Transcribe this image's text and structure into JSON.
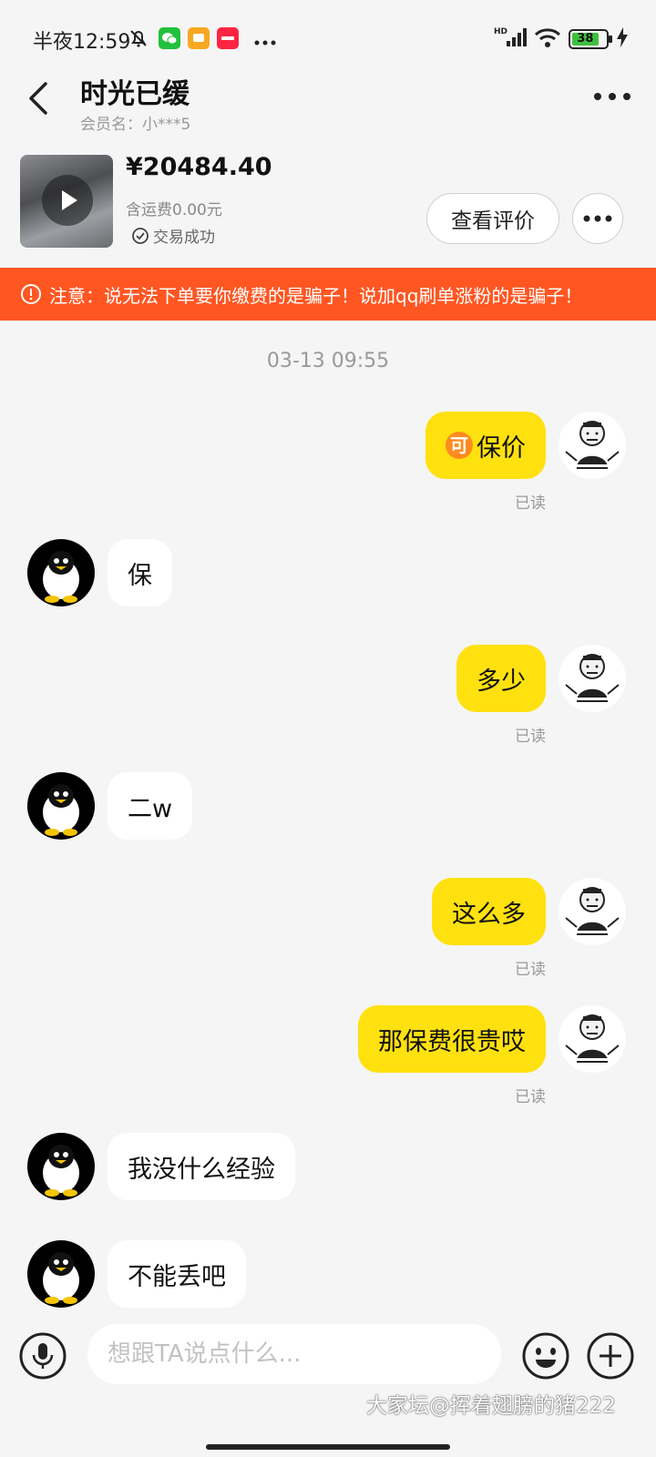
{
  "status_bar": {
    "time": "半夜12:59",
    "network": "HD",
    "battery": "38"
  },
  "header": {
    "title": "时光已缓",
    "member_label": "会员名：小***5"
  },
  "product": {
    "price": "¥20484.40",
    "shipping": "含运费0.00元",
    "status": "交易成功",
    "review_button": "查看评价"
  },
  "warning": {
    "text": "注意：说无法下单要你缴费的是骗子！说加qq刷单涨粉的是骗子！"
  },
  "chat": {
    "timestamp": "03-13 09:55",
    "read_label": "已读",
    "coin_glyph": "可",
    "messages": [
      {
        "side": "out",
        "text": "保价",
        "read": true
      },
      {
        "side": "in",
        "text": "保"
      },
      {
        "side": "out",
        "text": "多少",
        "read": true
      },
      {
        "side": "in",
        "text": "二w"
      },
      {
        "side": "out",
        "text": "这么多",
        "read": true
      },
      {
        "side": "out",
        "text": "那保费很贵哎",
        "read": true
      },
      {
        "side": "in",
        "text": "我没什么经验"
      },
      {
        "side": "in",
        "text": "不能丢吧"
      }
    ]
  },
  "input": {
    "placeholder": "想跟TA说点什么..."
  },
  "watermark": "大家坛@挥着翅膀的猪222",
  "colors": {
    "accent": "#ffe10f",
    "warning": "#ff5622",
    "background": "#f5f5f5"
  }
}
